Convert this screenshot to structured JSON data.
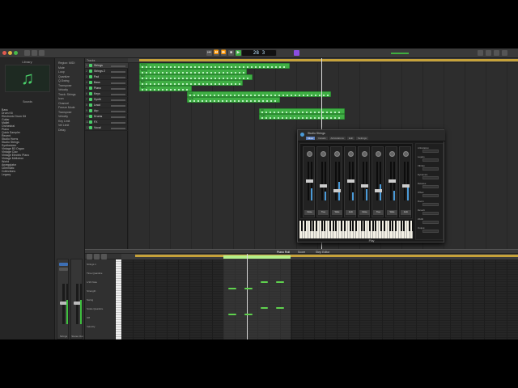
{
  "topbar": {
    "lcd_text": "28 3",
    "transport": [
      "⏮",
      "⏪",
      "⏩",
      "■",
      "▶",
      "●"
    ],
    "accent_color": "#8a4de0"
  },
  "library": {
    "title": "Library",
    "subtitle": "Sounds",
    "items": [
      "Bass",
      "Drum Kit",
      "Electronic Drum Kit",
      "Guitar",
      "Mallet",
      "Orchestral",
      "Piano",
      "Quick Sampler",
      "Recent",
      "Studio Horns",
      "Studio Strings",
      "Synthesizer",
      "Vintage B3 Organ",
      "Vintage Clav",
      "Vintage Electric Piano",
      "Vintage Mellotron",
      "World",
      "Arpeggiator",
      "Cinematic",
      "Collections",
      "Legacy"
    ]
  },
  "inspector": {
    "rows": [
      "Region: MIDI",
      "Mute",
      "Loop",
      "Quantize",
      "Q-Swing",
      "Transpose",
      "Velocity",
      "Track: Strings",
      "Icon",
      "Channel",
      "Freeze Mode",
      "Transpose",
      "Velocity",
      "Key Limit",
      "Vel Limit",
      "Delay"
    ],
    "channel_labels": [
      "Strings",
      "Stereo Out"
    ]
  },
  "tracks": {
    "header_label": "Tracks",
    "names": [
      "Strings",
      "Strings 2",
      "Pad",
      "Bass",
      "Piano",
      "Keys",
      "Synth",
      "Lead",
      "Arp",
      "Drums",
      "FX",
      "Vocal"
    ]
  },
  "arrange": {
    "regions": [
      {
        "label": "Strings",
        "row": 0,
        "start": 0.05,
        "len": 0.77
      },
      {
        "label": "Strings",
        "row": 1,
        "start": 0.05,
        "len": 0.55
      },
      {
        "label": "Pad",
        "row": 2,
        "start": 0.05,
        "len": 0.58
      },
      {
        "label": "Bass",
        "row": 3,
        "start": 0.05,
        "len": 0.53
      },
      {
        "label": "Piano",
        "row": 4,
        "start": 0.05,
        "len": 0.27
      },
      {
        "label": "Keys",
        "row": 5,
        "start": 0.26,
        "len": 0.74
      },
      {
        "label": "Synth",
        "row": 6,
        "start": 0.26,
        "len": 0.48
      },
      {
        "label": "Arp",
        "row": 8,
        "start": 0.58,
        "len": 0.44
      },
      {
        "label": "Lead",
        "row": 9,
        "start": 0.58,
        "len": 0.44
      }
    ]
  },
  "plugin": {
    "title": "Studio Strings",
    "tabs": [
      "Mixer",
      "Details",
      "Articulations",
      "Edit",
      "Settings"
    ],
    "mic_labels": [
      "Close",
      "Tree",
      "Wide",
      "Amb",
      "Close",
      "Tree",
      "Wide",
      "Amb"
    ],
    "meter_levels": [
      0.32,
      0.22,
      0.48,
      0.2,
      0.3,
      0.42,
      0.26,
      0.38
    ],
    "side_rows": [
      "Articulation",
      "Legato",
      "Vibrato",
      "Dynamics",
      "Release",
      "Offset",
      "Room",
      "Reverb",
      "Width",
      "Output"
    ],
    "footer": "Play"
  },
  "piano_roll": {
    "tabs": [
      "Piano Roll",
      "Score",
      "Step Editor"
    ],
    "left_rows": [
      "Strings 1",
      "Time Quantize",
      "1/16 Note",
      "Strength",
      "Swing",
      "Scale Quantize",
      "Off",
      "Velocity"
    ],
    "notes": [
      {
        "t": 0.27,
        "p": 0.35,
        "d": 0.02
      },
      {
        "t": 0.31,
        "p": 0.35,
        "d": 0.02
      },
      {
        "t": 0.35,
        "p": 0.27,
        "d": 0.02
      },
      {
        "t": 0.39,
        "p": 0.27,
        "d": 0.02
      },
      {
        "t": 0.27,
        "p": 0.68,
        "d": 0.02
      },
      {
        "t": 0.31,
        "p": 0.68,
        "d": 0.02
      },
      {
        "t": 0.35,
        "p": 0.6,
        "d": 0.02
      },
      {
        "t": 0.39,
        "p": 0.6,
        "d": 0.02
      }
    ]
  }
}
